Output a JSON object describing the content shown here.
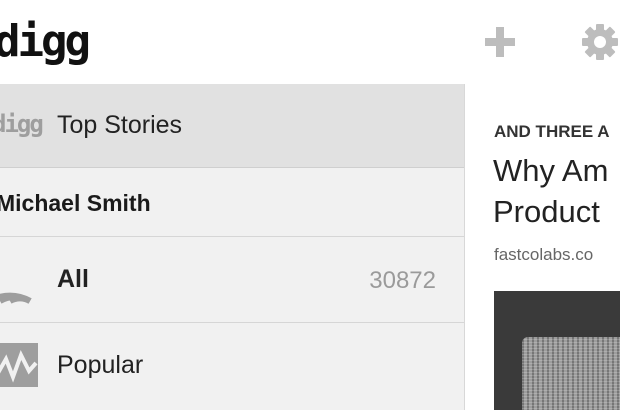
{
  "app": {
    "logo_text": "digg"
  },
  "toolbar": {
    "add_icon": "plus-icon",
    "settings_icon": "gear-icon"
  },
  "drawer": {
    "top_stories": {
      "icon_text": "digg",
      "label": "Top Stories"
    },
    "user": {
      "name": "Michael Smith"
    },
    "all": {
      "icon": "rss-feed-icon",
      "label": "All",
      "count": "30872"
    },
    "popular": {
      "icon": "pulse-chart-icon",
      "label": "Popular"
    }
  },
  "article": {
    "kicker": "AND THREE A",
    "headline_line1": "Why Am",
    "headline_line2": "Product",
    "source": "fastcolabs.co",
    "thumbnail": "tv-static-image"
  },
  "colors": {
    "accent_icon": "#9e9e9e",
    "drawer_bg": "#f0f0f0",
    "selected_bg": "#e1e1e1"
  }
}
